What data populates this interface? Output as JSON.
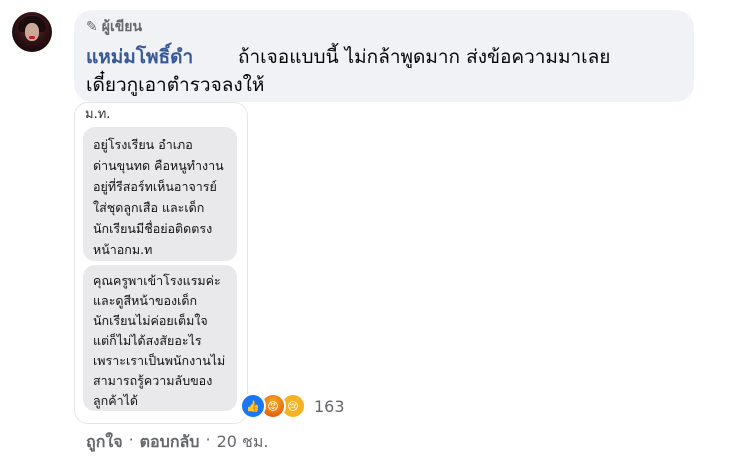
{
  "comment": {
    "badge_label": "ผู้เขียน",
    "author": "แหม่มโพธิ์ดำ",
    "text_line1": "ถ้าเจอแบบนี้ ไม่กล้าพูดมาก ส่งข้อความมาเลย",
    "text_line2": "เดี๋ยวกูเอาตำรวจลงให้"
  },
  "screenshot": {
    "top_label": "ม.ท.",
    "message1": [
      "อยู่โรงเรียน อำเภอ",
      "ด่านขุนทด คือหนูทำงาน",
      "อยู่ที่รีสอร์ทเห็นอาจารย์",
      "ใส่ชุดลูกเสือ และเด็ก",
      "นักเรียนมีชื่อย่อติดตรง",
      "หน้าอกม.ท"
    ],
    "message2": [
      "คุณครูพาเข้าโรงแรมค่ะ",
      "และดูสีหน้าของเด็ก",
      "นักเรียนไม่ค่อยเต็มใจ",
      "แต่ก็ไม่ได้สงสัยอะไร",
      "เพราะเราเป็นพนักงานไม่",
      "สามารถรู้ความลับของ",
      "ลูกค้าได้"
    ]
  },
  "reactions": {
    "count": "163",
    "icons": [
      "like-icon",
      "angry-icon",
      "sad-icon"
    ],
    "colors": {
      "like": "#1877f2",
      "angry": "#e9710f",
      "sad": "#f7b125"
    }
  },
  "actions": {
    "like": "ถูกใจ",
    "sep1": "·",
    "reply": "ตอบกลับ",
    "sep2": "·",
    "time": "20 ชม."
  },
  "colors": {
    "author": "#385898",
    "bubble": "#f0f2f5",
    "meta": "#65676b"
  }
}
